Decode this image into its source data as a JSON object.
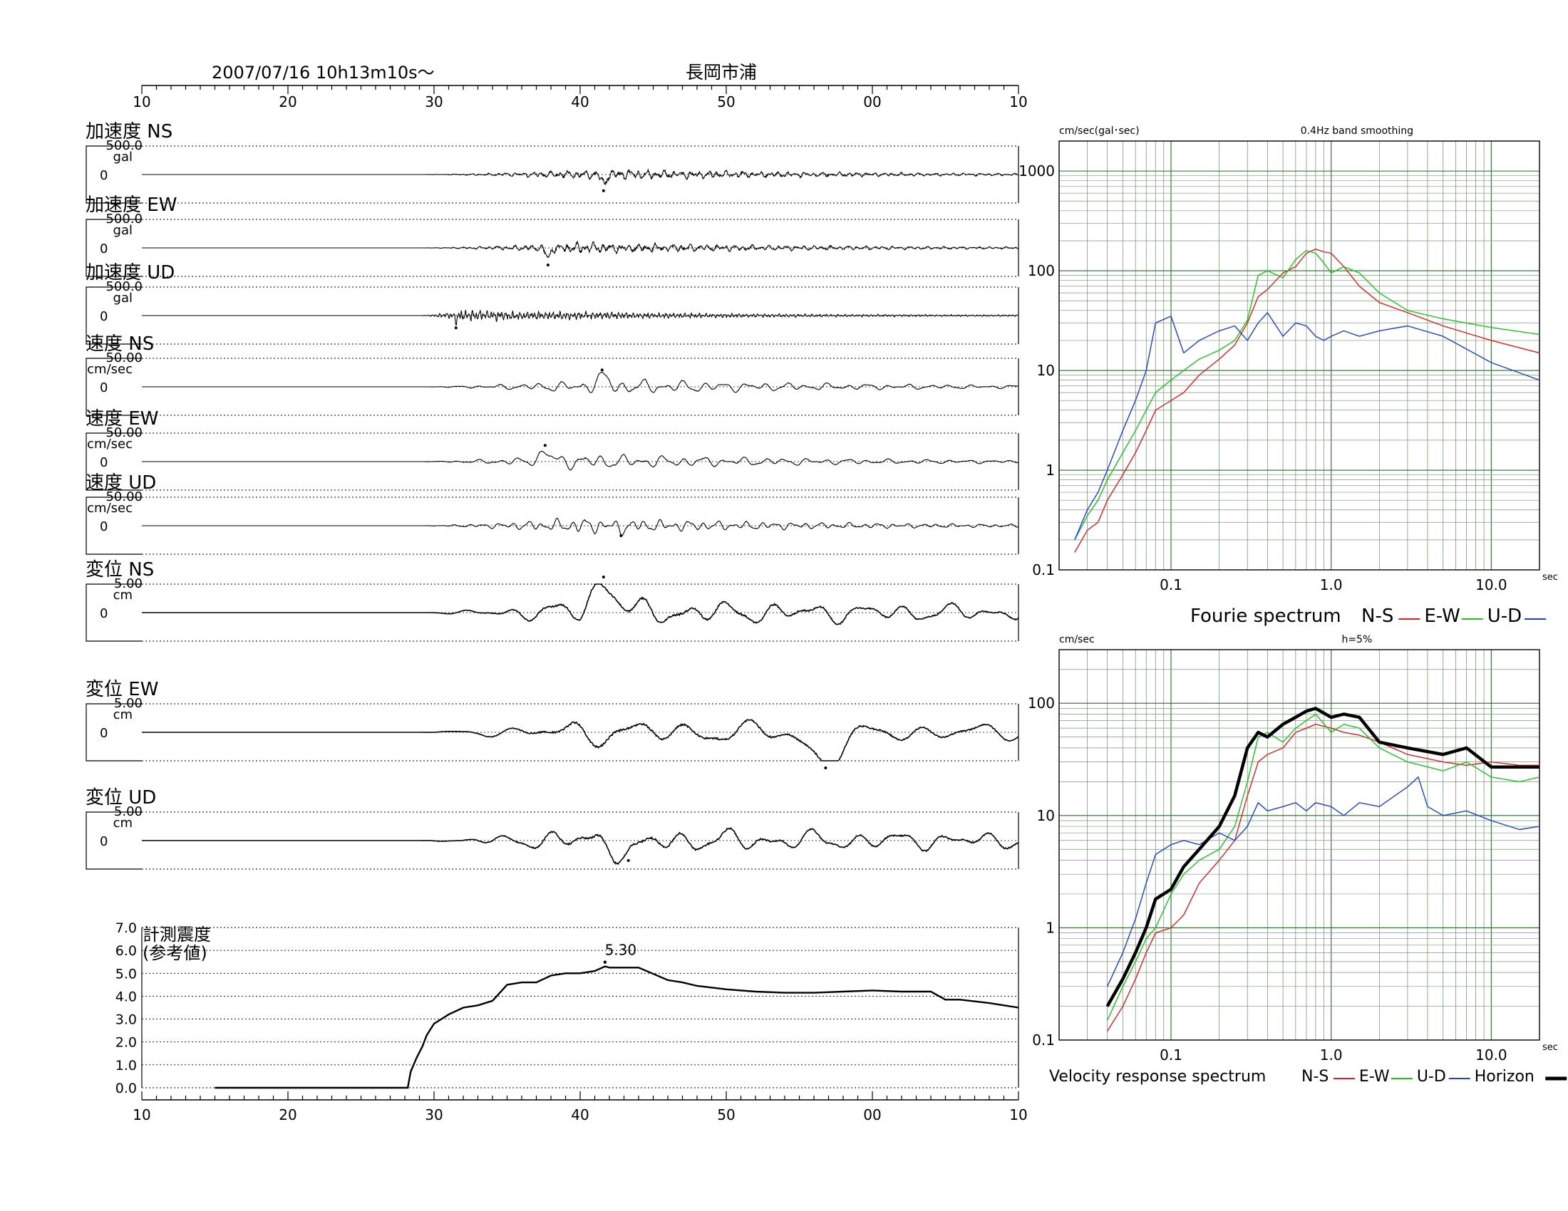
{
  "header": {
    "datetime": "2007/07/16  10h13m10s～",
    "station": "長岡市浦"
  },
  "time_axis": {
    "tick_labels": [
      "10",
      "20",
      "30",
      "40",
      "50",
      "00",
      "10"
    ],
    "tick_values": [
      0,
      10,
      20,
      30,
      40,
      50,
      60
    ],
    "range": [
      0,
      60
    ]
  },
  "chart_data": [
    {
      "id": "waveforms",
      "type": "line",
      "x_range": [
        0,
        60
      ],
      "panels": [
        {
          "label": "加速度 NS",
          "scale_label": "500.0",
          "unit": "gal",
          "zero_label": "0",
          "max": 500.0,
          "onset": 19.0,
          "peak_time": 31.6,
          "peak_sign": -1,
          "peak_frac": 0.32,
          "dominant_period": 0.6,
          "envelope": [
            19,
            32,
            60
          ],
          "kind": "acc"
        },
        {
          "label": "加速度 EW",
          "scale_label": "500.0",
          "unit": "gal",
          "zero_label": "0",
          "max": 500.0,
          "onset": 19.0,
          "peak_time": 27.8,
          "peak_sign": -1,
          "peak_frac": 0.35,
          "dominant_period": 0.6,
          "envelope": [
            19,
            30,
            60
          ],
          "kind": "acc"
        },
        {
          "label": "加速度 UD",
          "scale_label": "500.0",
          "unit": "gal",
          "zero_label": "0",
          "max": 500.0,
          "onset": 19.0,
          "peak_time": 21.5,
          "peak_sign": -1,
          "peak_frac": 0.18,
          "dominant_period": 0.25,
          "envelope": [
            19,
            22,
            40
          ],
          "kind": "acc"
        },
        {
          "label": "速度 NS",
          "scale_label": "50.00",
          "unit": "cm/sec",
          "zero_label": "0",
          "max": 50.0,
          "onset": 19.0,
          "peak_time": 31.5,
          "peak_sign": 1,
          "peak_frac": 0.34,
          "dominant_period": 1.4,
          "envelope": [
            19,
            32,
            60
          ],
          "kind": "vel"
        },
        {
          "label": "速度 EW",
          "scale_label": "50.00",
          "unit": "cm/sec",
          "zero_label": "0",
          "max": 50.0,
          "onset": 19.0,
          "peak_time": 27.6,
          "peak_sign": 1,
          "peak_frac": 0.32,
          "dominant_period": 1.4,
          "envelope": [
            19,
            30,
            60
          ],
          "kind": "vel"
        },
        {
          "label": "速度 UD",
          "scale_label": "50.00",
          "unit": "cm/sec",
          "zero_label": "0",
          "max": 50.0,
          "onset": 19.0,
          "peak_time": 32.8,
          "peak_sign": -1,
          "peak_frac": 0.1,
          "dominant_period": 1.0,
          "envelope": [
            19,
            30,
            60
          ],
          "kind": "vel"
        },
        {
          "label": "変位 NS",
          "scale_label": "5.00",
          "unit": "cm",
          "zero_label": "0",
          "max": 5.0,
          "onset": 19.0,
          "peak_time": 31.6,
          "peak_sign": 1,
          "peak_frac": 1.0,
          "dominant_period": 3.0,
          "envelope": [
            19,
            30,
            60
          ],
          "kind": "dis"
        },
        {
          "label": "変位 EW",
          "scale_label": "5.00",
          "unit": "cm",
          "zero_label": "0",
          "max": 5.0,
          "onset": 19.0,
          "peak_time": 46.8,
          "peak_sign": -1,
          "peak_frac": 1.0,
          "dominant_period": 4.0,
          "envelope": [
            19,
            30,
            60
          ],
          "kind": "dis"
        },
        {
          "label": "変位 UD",
          "scale_label": "5.00",
          "unit": "cm",
          "zero_label": "0",
          "max": 5.0,
          "onset": 19.0,
          "peak_time": 33.3,
          "peak_sign": -1,
          "peak_frac": 0.45,
          "dominant_period": 3.0,
          "envelope": [
            19,
            30,
            60
          ],
          "kind": "dis"
        }
      ]
    },
    {
      "id": "intensity",
      "type": "line",
      "ylabel": "計測震度\n(参考値)",
      "y_ticks": [
        "7.0",
        "6.0",
        "5.0",
        "4.0",
        "3.0",
        "2.0",
        "1.0",
        "0.0"
      ],
      "y_values": [
        7,
        6,
        5,
        4,
        3,
        2,
        1,
        0
      ],
      "ylim": [
        0,
        7
      ],
      "peak_label": "5.30",
      "peak_time": 31.7,
      "peak_value": 5.3,
      "x": [
        5,
        18.2,
        18.4,
        18.8,
        19.2,
        19.5,
        20.0,
        20.5,
        21.0,
        22.0,
        23.0,
        24.0,
        25.0,
        26.0,
        27.0,
        28.0,
        29.0,
        30.0,
        31.0,
        31.7,
        32.0,
        34.0,
        36.0,
        37.0,
        38.0,
        40.0,
        42.0,
        44.0,
        46.0,
        48.0,
        50.0,
        52.0,
        54.0,
        55.0,
        56.0,
        58.0,
        60.0
      ],
      "y": [
        0.0,
        0.0,
        0.7,
        1.3,
        1.8,
        2.3,
        2.8,
        3.0,
        3.2,
        3.5,
        3.6,
        3.8,
        4.5,
        4.6,
        4.6,
        4.9,
        5.0,
        5.0,
        5.1,
        5.3,
        5.25,
        5.25,
        4.7,
        4.6,
        4.45,
        4.3,
        4.2,
        4.15,
        4.15,
        4.2,
        4.25,
        4.2,
        4.2,
        3.85,
        3.85,
        3.7,
        3.5
      ]
    },
    {
      "id": "fourier",
      "type": "line",
      "title": "Fourie spectrum",
      "ylabel": "cm/sec(gal･sec)",
      "note": "0.4Hz band smoothing",
      "x_unit": "sec",
      "log_x": true,
      "log_y": true,
      "xlim": [
        0.02,
        20
      ],
      "ylim": [
        0.1,
        2000
      ],
      "x_tick_labels": [
        "0.1",
        "1.0",
        "10.0"
      ],
      "x_tick_values": [
        0.1,
        1.0,
        10.0
      ],
      "y_tick_labels": [
        "1000",
        "100",
        "10",
        "1",
        "0.1"
      ],
      "y_tick_values": [
        1000,
        100,
        10,
        1,
        0.1
      ],
      "series": [
        {
          "name": "N-S",
          "color": "#e0201f",
          "x": [
            0.025,
            0.03,
            0.035,
            0.04,
            0.05,
            0.06,
            0.07,
            0.08,
            0.1,
            0.12,
            0.15,
            0.2,
            0.25,
            0.3,
            0.35,
            0.4,
            0.5,
            0.6,
            0.7,
            0.8,
            0.9,
            1.0,
            1.2,
            1.5,
            2.0,
            3.0,
            5.0,
            10.0,
            20.0
          ],
          "y": [
            0.15,
            0.25,
            0.3,
            0.5,
            0.9,
            1.5,
            2.5,
            4,
            5,
            6,
            9,
            13,
            18,
            30,
            55,
            65,
            95,
            110,
            150,
            165,
            155,
            150,
            110,
            70,
            48,
            38,
            28,
            20,
            15
          ]
        },
        {
          "name": "E-W",
          "color": "#1ec41e",
          "x": [
            0.025,
            0.03,
            0.035,
            0.04,
            0.05,
            0.06,
            0.07,
            0.08,
            0.1,
            0.12,
            0.15,
            0.2,
            0.25,
            0.3,
            0.35,
            0.4,
            0.5,
            0.6,
            0.7,
            0.8,
            0.9,
            1.0,
            1.2,
            1.5,
            2.0,
            3.0,
            5.0,
            10.0,
            20.0
          ],
          "y": [
            0.2,
            0.35,
            0.5,
            0.8,
            1.5,
            2.5,
            4,
            6,
            8,
            10,
            13,
            16,
            20,
            32,
            90,
            100,
            85,
            130,
            160,
            150,
            120,
            95,
            110,
            95,
            60,
            40,
            33,
            27,
            23
          ]
        },
        {
          "name": "U-D",
          "color": "#1f3fd8",
          "x": [
            0.025,
            0.03,
            0.035,
            0.04,
            0.05,
            0.06,
            0.07,
            0.08,
            0.1,
            0.12,
            0.15,
            0.2,
            0.25,
            0.3,
            0.35,
            0.4,
            0.5,
            0.6,
            0.7,
            0.8,
            0.9,
            1.0,
            1.2,
            1.5,
            2.0,
            3.0,
            5.0,
            10.0,
            20.0
          ],
          "y": [
            0.2,
            0.4,
            0.6,
            1.0,
            2.5,
            5,
            10,
            30,
            35,
            15,
            20,
            25,
            28,
            20,
            30,
            38,
            22,
            30,
            28,
            22,
            20,
            22,
            25,
            22,
            25,
            28,
            22,
            12,
            8
          ]
        }
      ]
    },
    {
      "id": "response",
      "type": "line",
      "title": "Velocity response spectrum",
      "ylabel": "cm/sec",
      "note": "h=5%",
      "x_unit": "sec",
      "log_x": true,
      "log_y": true,
      "xlim": [
        0.02,
        20
      ],
      "ylim": [
        0.1,
        300
      ],
      "x_tick_labels": [
        "0.1",
        "1.0",
        "10.0"
      ],
      "x_tick_values": [
        0.1,
        1.0,
        10.0
      ],
      "y_tick_labels": [
        "100",
        "10",
        "1",
        "0.1"
      ],
      "y_tick_values": [
        100,
        10,
        1,
        0.1
      ],
      "series": [
        {
          "name": "N-S",
          "color": "#e0201f",
          "width": 1.4,
          "x": [
            0.04,
            0.05,
            0.06,
            0.07,
            0.08,
            0.1,
            0.12,
            0.15,
            0.2,
            0.25,
            0.3,
            0.35,
            0.4,
            0.5,
            0.6,
            0.7,
            0.8,
            1.0,
            1.2,
            1.5,
            2.0,
            3.0,
            5.0,
            7.0,
            10.0,
            15.0,
            20.0
          ],
          "y": [
            0.12,
            0.2,
            0.35,
            0.6,
            0.9,
            1.0,
            1.3,
            2.5,
            4,
            6,
            15,
            30,
            35,
            40,
            55,
            60,
            65,
            60,
            55,
            52,
            45,
            35,
            30,
            28,
            30,
            28,
            28
          ]
        },
        {
          "name": "E-W",
          "color": "#1ec41e",
          "width": 1.4,
          "x": [
            0.04,
            0.05,
            0.06,
            0.07,
            0.08,
            0.1,
            0.12,
            0.15,
            0.2,
            0.25,
            0.3,
            0.35,
            0.4,
            0.5,
            0.6,
            0.7,
            0.8,
            1.0,
            1.2,
            1.5,
            2.0,
            3.0,
            5.0,
            7.0,
            10.0,
            15.0,
            20.0
          ],
          "y": [
            0.15,
            0.3,
            0.5,
            0.8,
            1.0,
            2.0,
            3.0,
            4.0,
            5.0,
            8,
            20,
            50,
            55,
            45,
            60,
            70,
            80,
            55,
            65,
            60,
            40,
            30,
            25,
            30,
            22,
            20,
            22
          ]
        },
        {
          "name": "U-D",
          "color": "#1f3fd8",
          "width": 1.4,
          "x": [
            0.04,
            0.05,
            0.06,
            0.07,
            0.08,
            0.1,
            0.12,
            0.15,
            0.2,
            0.25,
            0.3,
            0.35,
            0.4,
            0.5,
            0.6,
            0.7,
            0.8,
            1.0,
            1.2,
            1.5,
            2.0,
            3.0,
            3.5,
            4.0,
            5.0,
            7.0,
            10.0,
            15.0,
            20.0
          ],
          "y": [
            0.3,
            0.6,
            1.2,
            2.5,
            4.5,
            5.5,
            6,
            5.5,
            7,
            6,
            8,
            13,
            11,
            12,
            13,
            11,
            13,
            12,
            10,
            13,
            12,
            18,
            22,
            12,
            10,
            11,
            9,
            7.5,
            8
          ]
        },
        {
          "name": "Horizon",
          "color": "#000000",
          "width": 4.5,
          "x": [
            0.04,
            0.05,
            0.06,
            0.07,
            0.08,
            0.1,
            0.12,
            0.15,
            0.2,
            0.25,
            0.3,
            0.35,
            0.4,
            0.5,
            0.6,
            0.7,
            0.8,
            1.0,
            1.2,
            1.5,
            2.0,
            3.0,
            5.0,
            7.0,
            10.0,
            15.0,
            20.0
          ],
          "y": [
            0.2,
            0.35,
            0.6,
            1.0,
            1.8,
            2.2,
            3.5,
            5,
            8,
            15,
            40,
            55,
            50,
            65,
            75,
            85,
            90,
            75,
            80,
            75,
            45,
            40,
            35,
            40,
            27,
            27,
            27
          ]
        }
      ]
    }
  ]
}
